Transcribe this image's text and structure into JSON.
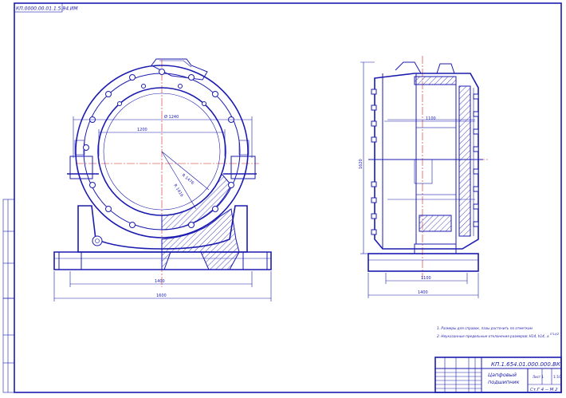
{
  "stamp_top": "КП.0000.00.01.1.5.94.ИМ",
  "colors": {
    "line": "#1b1bb0",
    "axis": "#d42020",
    "paper": "#ffffff"
  },
  "front_view": {
    "dims": [
      "Ø 1240",
      "1200",
      "R 1476",
      "R 1416",
      "1400",
      "1600"
    ]
  },
  "side_view": {
    "dims": [
      "1100",
      "1620",
      "1100",
      "1400"
    ]
  },
  "notes": [
    "1. Размеры для справок, пазы расточить по отметкам",
    "2. Неуказанные предельные отклонения размеров: Н14, h14, ±",
    "IT14/2"
  ],
  "title_block": {
    "doc_number": "КП.1.654.01.000.000.ВК",
    "name_line1": "Цапфовый",
    "name_line2": "подшипник",
    "material": "Ст.Г 4 -- М 2",
    "scale": "1:10",
    "sheet": "Лист 1"
  }
}
